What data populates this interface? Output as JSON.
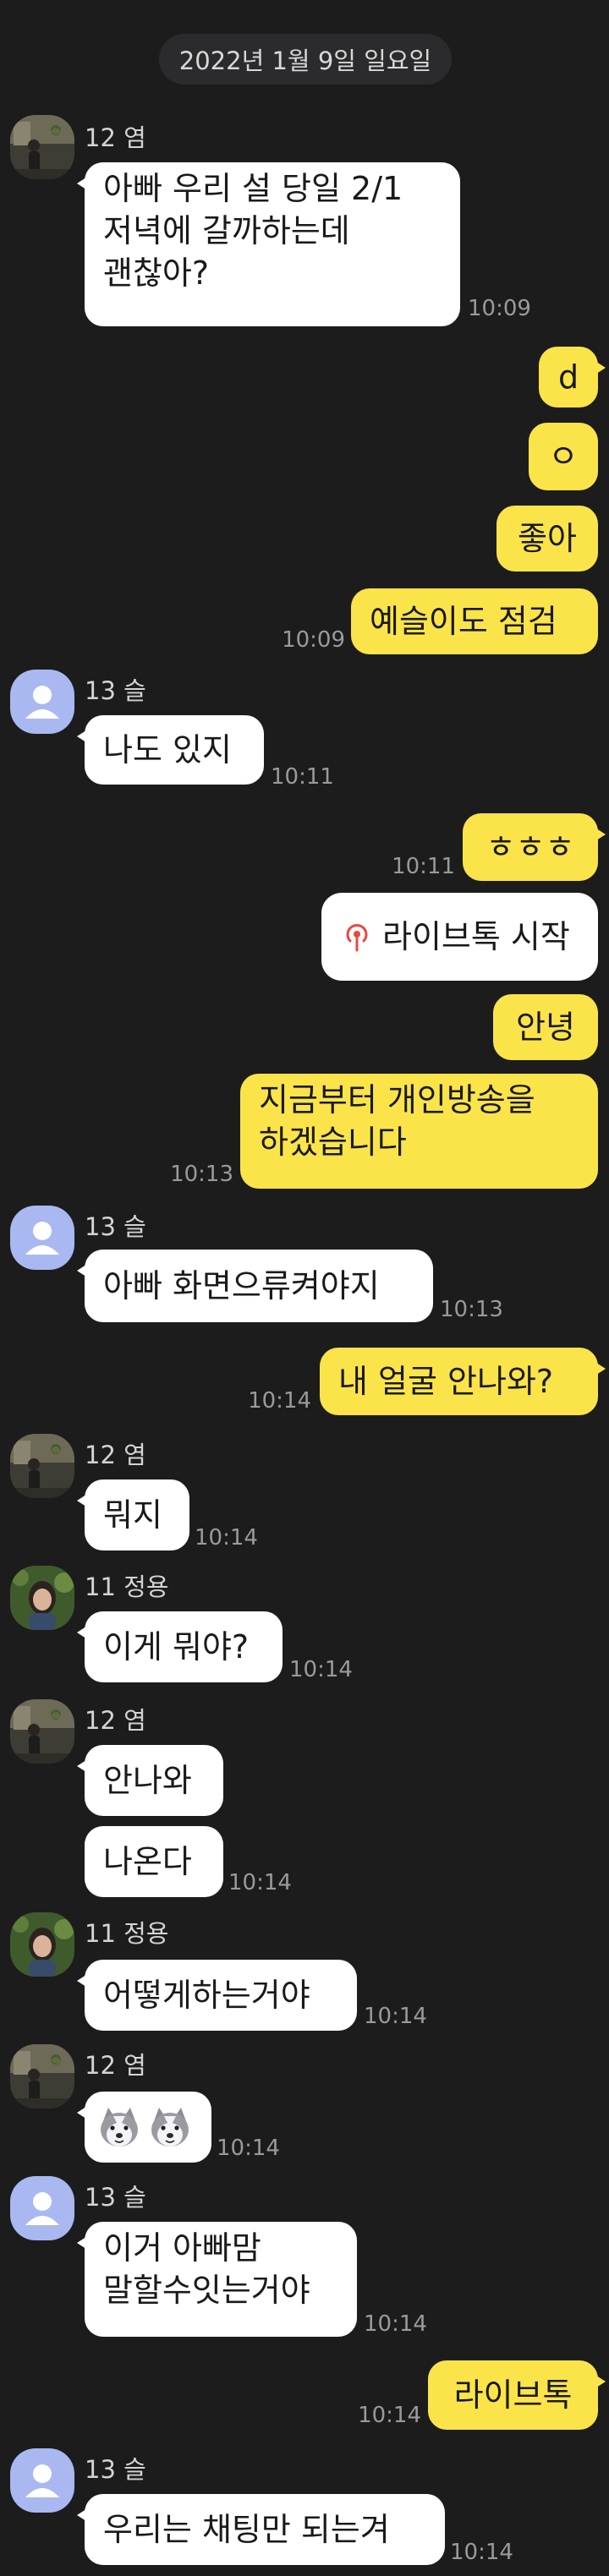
{
  "date_header": "2022년 1월 9일 일요일",
  "contacts": {
    "yeom": "12 염",
    "seul": "13 슬",
    "jeongyong": "11 정용"
  },
  "messages": {
    "m1_l1": "아빠 우리 설 당일 2/1",
    "m1_l2": "저녁에 갈까하는데",
    "m1_l3": "괜찮아?",
    "m1_time": "10:09",
    "m2": "d",
    "m3": "ㅇ",
    "m4": "좋아",
    "m5": "예슬이도 점검",
    "m5_time": "10:09",
    "m6": "나도 있지",
    "m6_time": "10:11",
    "m7": "ㅎㅎㅎ",
    "m7_time": "10:11",
    "m8": "라이브톡 시작",
    "m9": "안녕",
    "m10_l1": "지금부터 개인방송을",
    "m10_l2": "하겠습니다",
    "m10_time": "10:13",
    "m11": "아빠 화면으류켜야지",
    "m11_time": "10:13",
    "m12": "내 얼굴 안나와?",
    "m12_time": "10:14",
    "m13": "뭐지",
    "m13_time": "10:14",
    "m14": "이게 뭐야?",
    "m14_time": "10:14",
    "m15": "안나와",
    "m16": "나온다",
    "m16_time": "10:14",
    "m17": "어떻게하는거야",
    "m17_time": "10:14",
    "m18_time": "10:14",
    "m19_l1": "이거 아빠맘",
    "m19_l2": "말할수잇는거야",
    "m19_time": "10:14",
    "m20": "라이브톡",
    "m20_time": "10:14",
    "m21": "우리는 채팅만 되는겨",
    "m21_time": "10:14"
  },
  "colors": {
    "background": "#1c1c1d",
    "incoming_bubble": "#ffffff",
    "outgoing_bubble": "#fbe44a",
    "default_avatar": "#a9b8f0",
    "live_icon": "#e8483f"
  },
  "icons": {
    "live": "live-broadcast-icon",
    "emoji": "husky-dog-emoticon"
  }
}
